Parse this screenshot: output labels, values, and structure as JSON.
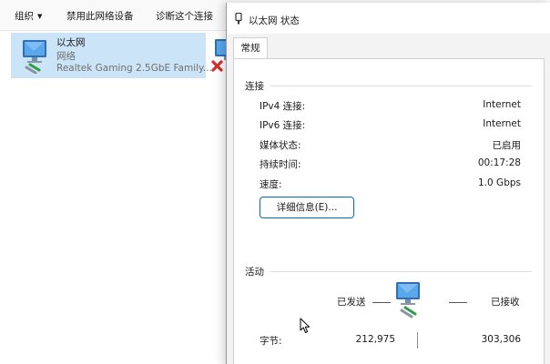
{
  "explorer": {
    "toolbar": {
      "organize_label": "组织",
      "disable_label": "禁用此网络设备",
      "diagnose_label": "诊断这个连接"
    },
    "connection": {
      "name": "以太网",
      "type": "网络",
      "device": "Realtek Gaming 2.5GbE Family..."
    },
    "second_connection": {
      "icon": "network-disconnected-icon"
    }
  },
  "dialog": {
    "title": "以太网 状态",
    "tab_label": "常规",
    "connection_section": {
      "heading": "连接",
      "rows": [
        {
          "label": "IPv4 连接:",
          "value": "Internet"
        },
        {
          "label": "IPv6 连接:",
          "value": "Internet"
        },
        {
          "label": "媒体状态:",
          "value": "已启用"
        },
        {
          "label": "持续时间:",
          "value": "00:17:28"
        },
        {
          "label": "速度:",
          "value": "1.0 Gbps"
        }
      ],
      "details_button_label": "详细信息(E)..."
    },
    "activity_section": {
      "heading": "活动",
      "sent_label": "已发送",
      "received_label": "已接收",
      "bytes_label": "字节:",
      "bytes_sent": "212,975",
      "bytes_received": "303,306"
    }
  },
  "colors": {
    "selection": "#cce4f7",
    "accent": "#0067c0",
    "dialog_background": "#f3f3f3",
    "error_red": "#d32f2f"
  }
}
